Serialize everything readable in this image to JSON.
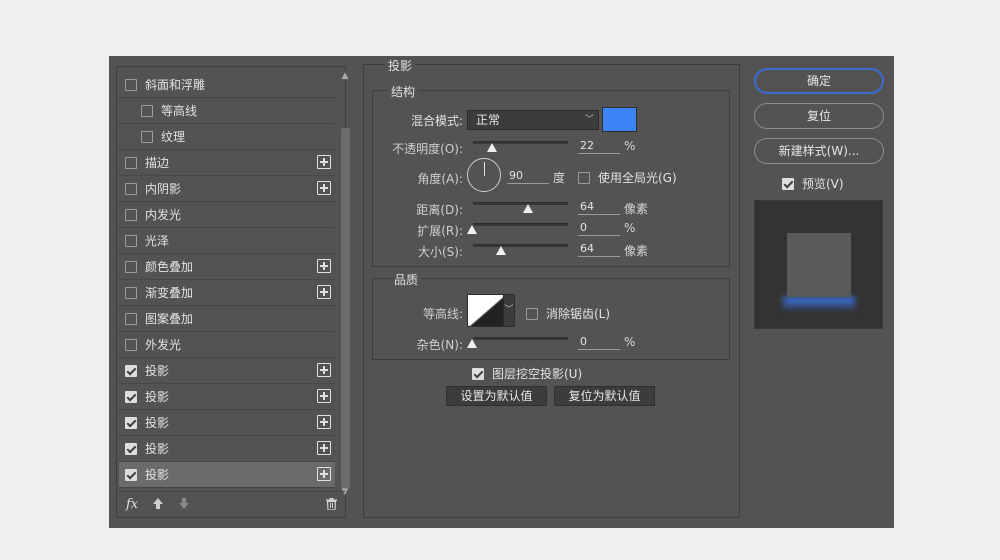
{
  "style_list": {
    "items": [
      {
        "label": "斜面和浮雕",
        "checked": false,
        "indent": false,
        "plus": false
      },
      {
        "label": "等高线",
        "checked": false,
        "indent": true,
        "plus": false
      },
      {
        "label": "纹理",
        "checked": false,
        "indent": true,
        "plus": false
      },
      {
        "label": "描边",
        "checked": false,
        "indent": false,
        "plus": true
      },
      {
        "label": "内阴影",
        "checked": false,
        "indent": false,
        "plus": true
      },
      {
        "label": "内发光",
        "checked": false,
        "indent": false,
        "plus": false
      },
      {
        "label": "光泽",
        "checked": false,
        "indent": false,
        "plus": false
      },
      {
        "label": "颜色叠加",
        "checked": false,
        "indent": false,
        "plus": true
      },
      {
        "label": "渐变叠加",
        "checked": false,
        "indent": false,
        "plus": true
      },
      {
        "label": "图案叠加",
        "checked": false,
        "indent": false,
        "plus": false
      },
      {
        "label": "外发光",
        "checked": false,
        "indent": false,
        "plus": false
      },
      {
        "label": "投影",
        "checked": true,
        "indent": false,
        "plus": true
      },
      {
        "label": "投影",
        "checked": true,
        "indent": false,
        "plus": true
      },
      {
        "label": "投影",
        "checked": true,
        "indent": false,
        "plus": true
      },
      {
        "label": "投影",
        "checked": true,
        "indent": false,
        "plus": true
      },
      {
        "label": "投影",
        "checked": true,
        "indent": false,
        "plus": true,
        "selected": true
      }
    ],
    "fx_label": "fx"
  },
  "drop_shadow": {
    "title": "投影",
    "structure": {
      "title": "结构",
      "blend_mode_label": "混合模式:",
      "blend_mode_value": "正常",
      "shadow_color": "#3d85f7",
      "opacity_label": "不透明度(O):",
      "opacity_value": "22",
      "opacity_unit": "%",
      "angle_label": "角度(A):",
      "angle_value": "90",
      "angle_unit": "度",
      "global_light_label": "使用全局光(G)",
      "global_light_checked": false,
      "distance_label": "距离(D):",
      "distance_value": "64",
      "distance_unit": "像素",
      "spread_label": "扩展(R):",
      "spread_value": "0",
      "spread_unit": "%",
      "size_label": "大小(S):",
      "size_value": "64",
      "size_unit": "像素"
    },
    "quality": {
      "title": "品质",
      "contour_label": "等高线:",
      "anti_alias_label": "消除锯齿(L)",
      "anti_alias_checked": false,
      "noise_label": "杂色(N):",
      "noise_value": "0",
      "noise_unit": "%"
    },
    "knockout_label": "图层挖空投影(U)",
    "knockout_checked": true,
    "set_default_label": "设置为默认值",
    "reset_default_label": "复位为默认值"
  },
  "actions": {
    "ok_label": "确定",
    "reset_label": "复位",
    "new_style_label": "新建样式(W)...",
    "preview_label": "预览(V)",
    "preview_checked": true
  }
}
